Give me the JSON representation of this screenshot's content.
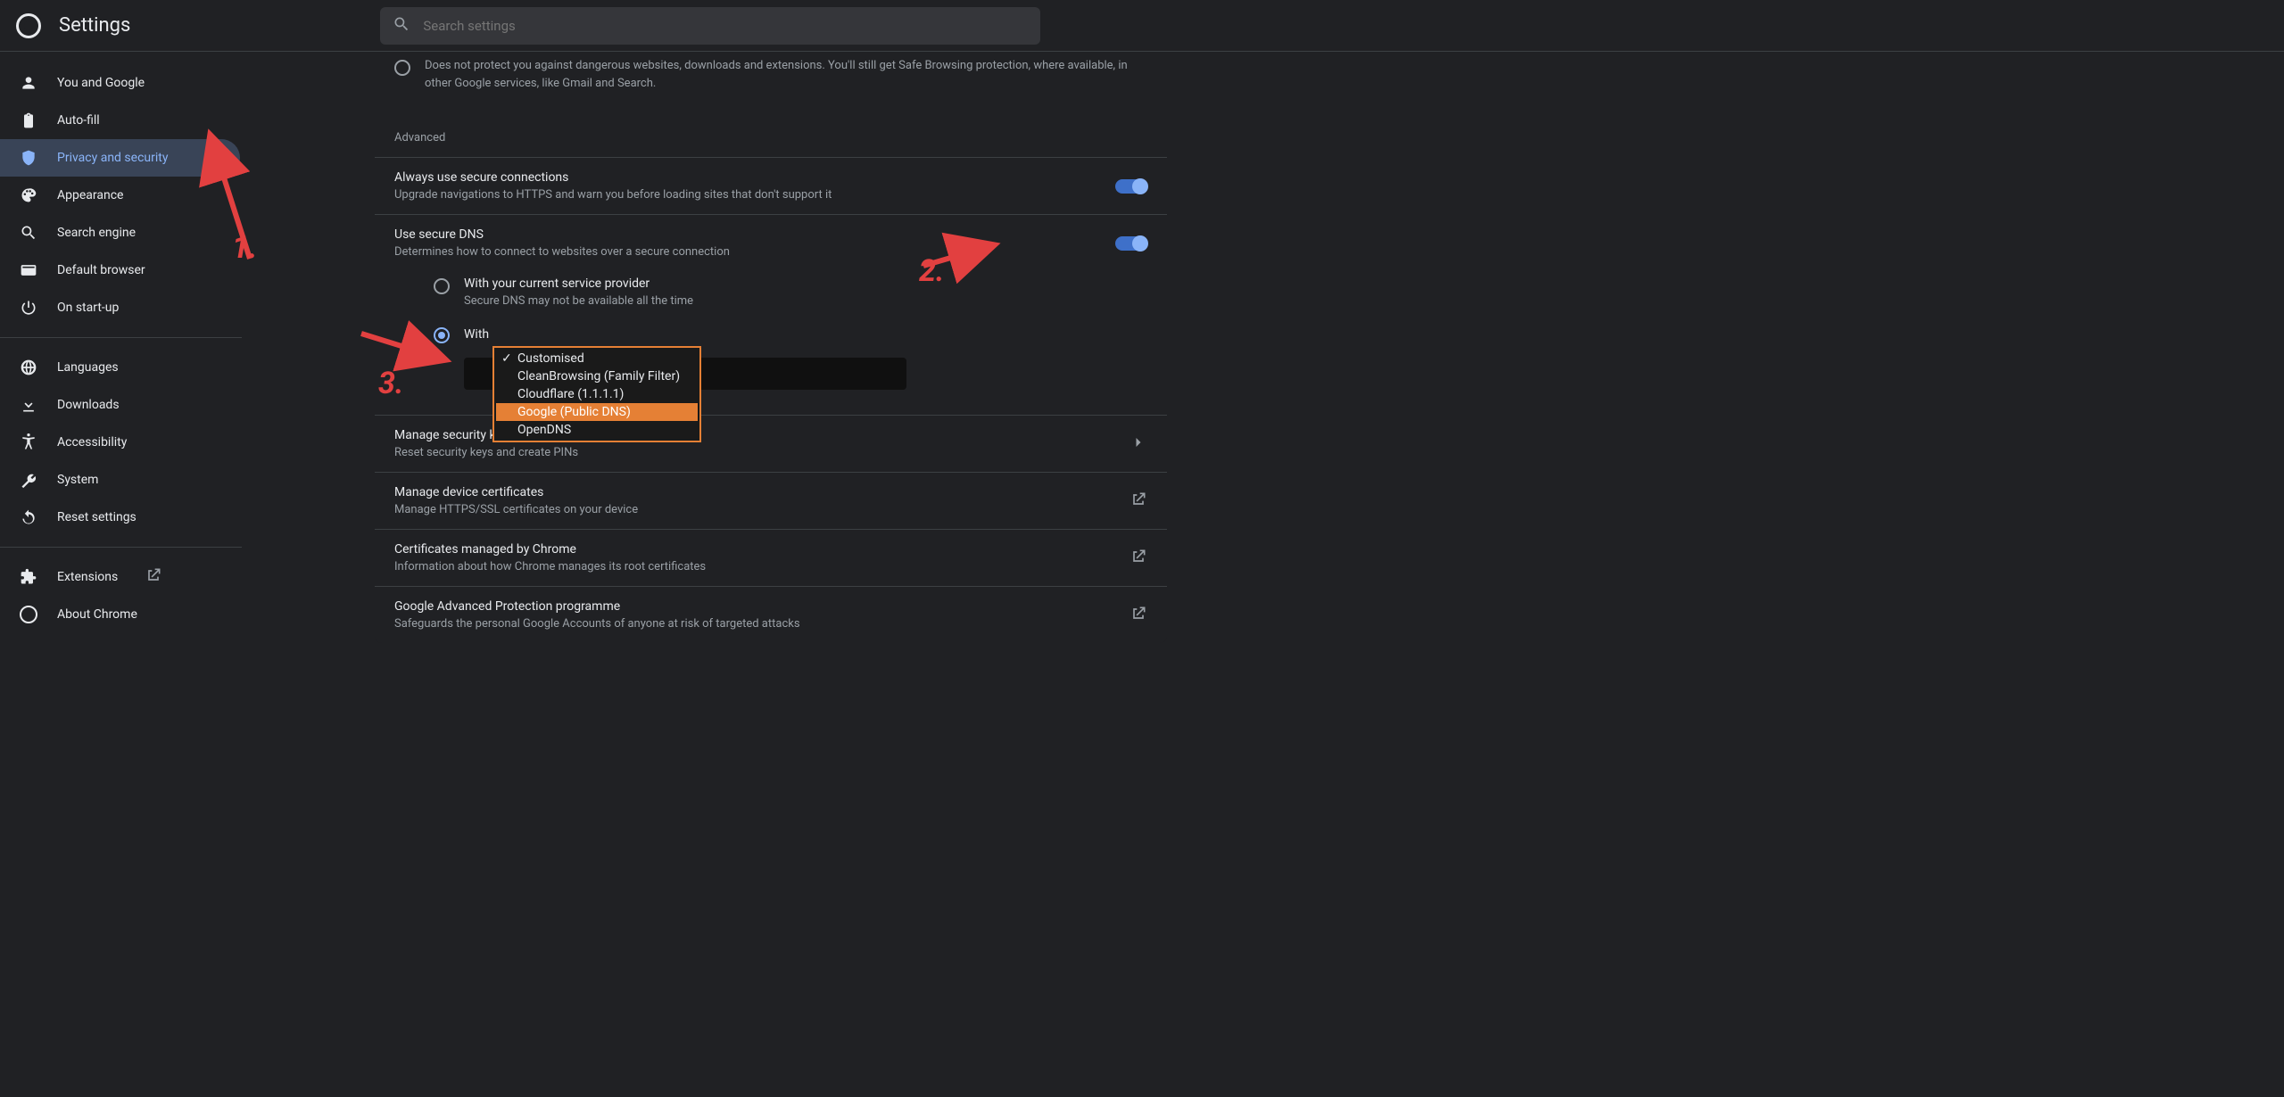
{
  "header": {
    "title": "Settings",
    "search_placeholder": "Search settings"
  },
  "sidebar": {
    "items": [
      {
        "label": "You and Google"
      },
      {
        "label": "Auto-fill"
      },
      {
        "label": "Privacy and security"
      },
      {
        "label": "Appearance"
      },
      {
        "label": "Search engine"
      },
      {
        "label": "Default browser"
      },
      {
        "label": "On start-up"
      }
    ],
    "group2": [
      {
        "label": "Languages"
      },
      {
        "label": "Downloads"
      },
      {
        "label": "Accessibility"
      },
      {
        "label": "System"
      },
      {
        "label": "Reset settings"
      }
    ],
    "group3": [
      {
        "label": "Extensions"
      },
      {
        "label": "About Chrome"
      }
    ]
  },
  "main": {
    "prelude_desc": "Does not protect you against dangerous websites, downloads and extensions. You'll still get Safe Browsing protection, where available, in other Google services, like Gmail and Search.",
    "advanced_title": "Advanced",
    "https": {
      "title": "Always use secure connections",
      "desc": "Upgrade navigations to HTTPS and warn you before loading sites that don't support it",
      "on": true
    },
    "dns": {
      "title": "Use secure DNS",
      "desc": "Determines how to connect to websites over a secure connection",
      "on": true,
      "opt1": {
        "title": "With your current service provider",
        "desc": "Secure DNS may not be available all the time"
      },
      "opt2": {
        "title": "With"
      },
      "dropdown": {
        "selected": "Customised",
        "options": [
          "Customised",
          "CleanBrowsing (Family Filter)",
          "Cloudflare (1.1.1.1)",
          "Google (Public DNS)",
          "OpenDNS"
        ],
        "highlight_index": 3
      }
    },
    "keys": {
      "title": "Manage security keys",
      "desc": "Reset security keys and create PINs"
    },
    "device_certs": {
      "title": "Manage device certificates",
      "desc": "Manage HTTPS/SSL certificates on your device"
    },
    "chrome_certs": {
      "title": "Certificates managed by Chrome",
      "desc": "Information about how Chrome manages its root certificates"
    },
    "gap": {
      "title": "Google Advanced Protection programme",
      "desc": "Safeguards the personal Google Accounts of anyone at risk of targeted attacks"
    }
  },
  "anno": {
    "n1": "1.",
    "n2": "2.",
    "n3": "3."
  }
}
